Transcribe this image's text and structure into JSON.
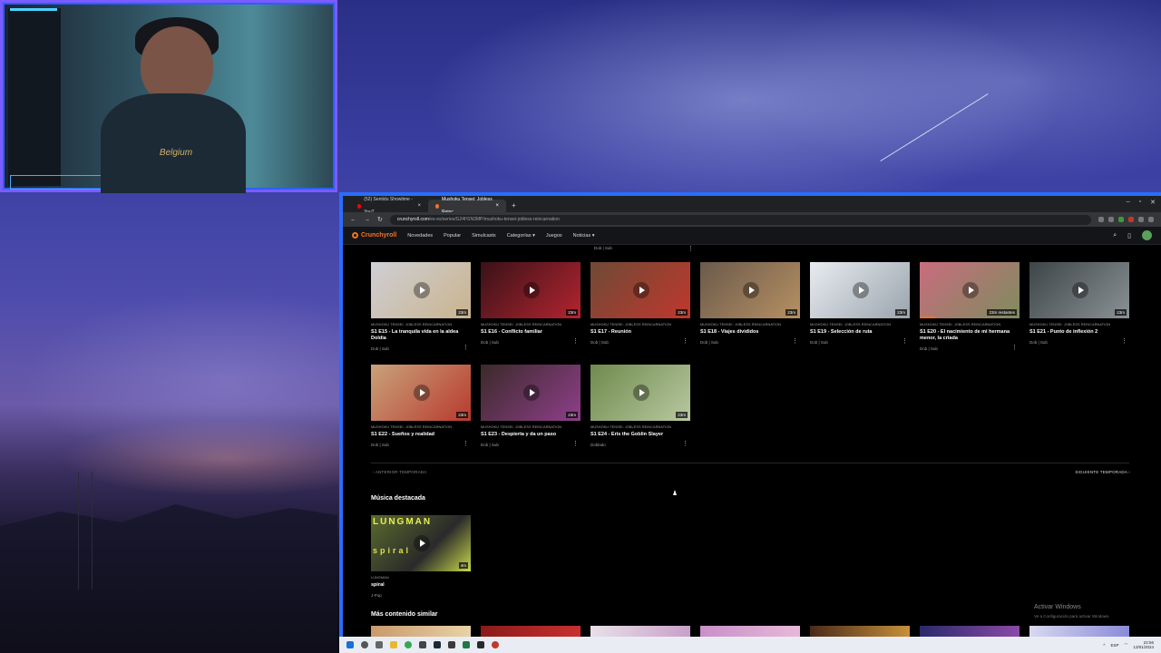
{
  "browser": {
    "tabs": [
      {
        "label": "(52) Sentidu Showtime - YouT",
        "color": "#ff0000"
      },
      {
        "label": "Mushoku Tensei: Jobless Reinc",
        "color": "#f47521"
      }
    ],
    "url_host": "crunchyroll.com",
    "url_path": "/es-es/series/G24H1N3MP/mushoku-tensei-jobless-reincarnation"
  },
  "site": {
    "logo": "Crunchyroll",
    "nav": [
      "Novedades",
      "Popular",
      "Simulcasts",
      "Categorías ▾",
      "Juegos",
      "Noticias ▾"
    ]
  },
  "top_meta": "Dob | Sub",
  "series_name": "MUSHOKU TENSEI: JOBLESS REINCARNATION",
  "episodes": [
    {
      "title": "S1 E15 - La tranquila vida en la aldea Doldia",
      "sub": "Dob | Sub",
      "duration": "23m",
      "colors": [
        "#cfcfd4",
        "#c9b38e"
      ]
    },
    {
      "title": "S1 E16 - Conflicto familiar",
      "sub": "Dob | Sub",
      "duration": "23m",
      "colors": [
        "#3a1218",
        "#b32430"
      ]
    },
    {
      "title": "S1 E17 - Reunión",
      "sub": "Dob | Sub",
      "duration": "23m",
      "colors": [
        "#6e4a36",
        "#c0372d"
      ]
    },
    {
      "title": "S1 E18 - Viajes divididos",
      "sub": "Dob | Sub",
      "duration": "23m",
      "colors": [
        "#6b5a4c",
        "#b69062"
      ]
    },
    {
      "title": "S1 E19 - Selección de ruta",
      "sub": "Dob | Sub",
      "duration": "23m",
      "colors": [
        "#e8ecf0",
        "#9aa4ae"
      ]
    },
    {
      "title": "S1 E20 - El nacimiento de mi hermana menor, la criada",
      "sub": "Dob | Sub",
      "duration": "23m restantes",
      "colors": [
        "#c96c7e",
        "#7e8c5e"
      ],
      "progress": 0.15
    },
    {
      "title": "S1 E21 - Punto de inflexión 2",
      "sub": "Dob | Sub",
      "duration": "23m",
      "colors": [
        "#3e4548",
        "#8b9295"
      ]
    },
    {
      "title": "S1 E22 - Sueños y realidad",
      "sub": "Dob | Sub",
      "duration": "23m",
      "colors": [
        "#c9a27a",
        "#b83a2f"
      ]
    },
    {
      "title": "S1 E23 - Despierta y da un paso",
      "sub": "Dob | Sub",
      "duration": "23m",
      "colors": [
        "#3b2a2a",
        "#8e3f8a"
      ]
    },
    {
      "title": "S1 E24 - Eris the Goblin Slayer",
      "sub": "Doblado",
      "duration": "23m",
      "colors": [
        "#6f8a4e",
        "#b8c8a0"
      ]
    }
  ],
  "season_nav": {
    "prev": "‹  ANTERIOR TEMPORADA",
    "next": "SIGUIENTE TEMPORADA  ›"
  },
  "music": {
    "heading": "Música destacada",
    "card": {
      "series": "LUNGMAN",
      "title": "spiral",
      "sub": "J-Pop",
      "duration": "4m",
      "overlay_top": "LUNGMAN",
      "overlay_bottom": "spiral",
      "colors": [
        "#5a6a2e",
        "#c8d84a"
      ]
    }
  },
  "similar": {
    "heading": "Más contenido similar"
  },
  "watermark": {
    "line1": "Activar Windows",
    "line2": "Ve a Configuración para activar Windows."
  },
  "taskbar": {
    "lang": "ESP",
    "time": "22:56",
    "date": "13/01/2024"
  },
  "webcam": {
    "shirt_text": "Belgium"
  }
}
